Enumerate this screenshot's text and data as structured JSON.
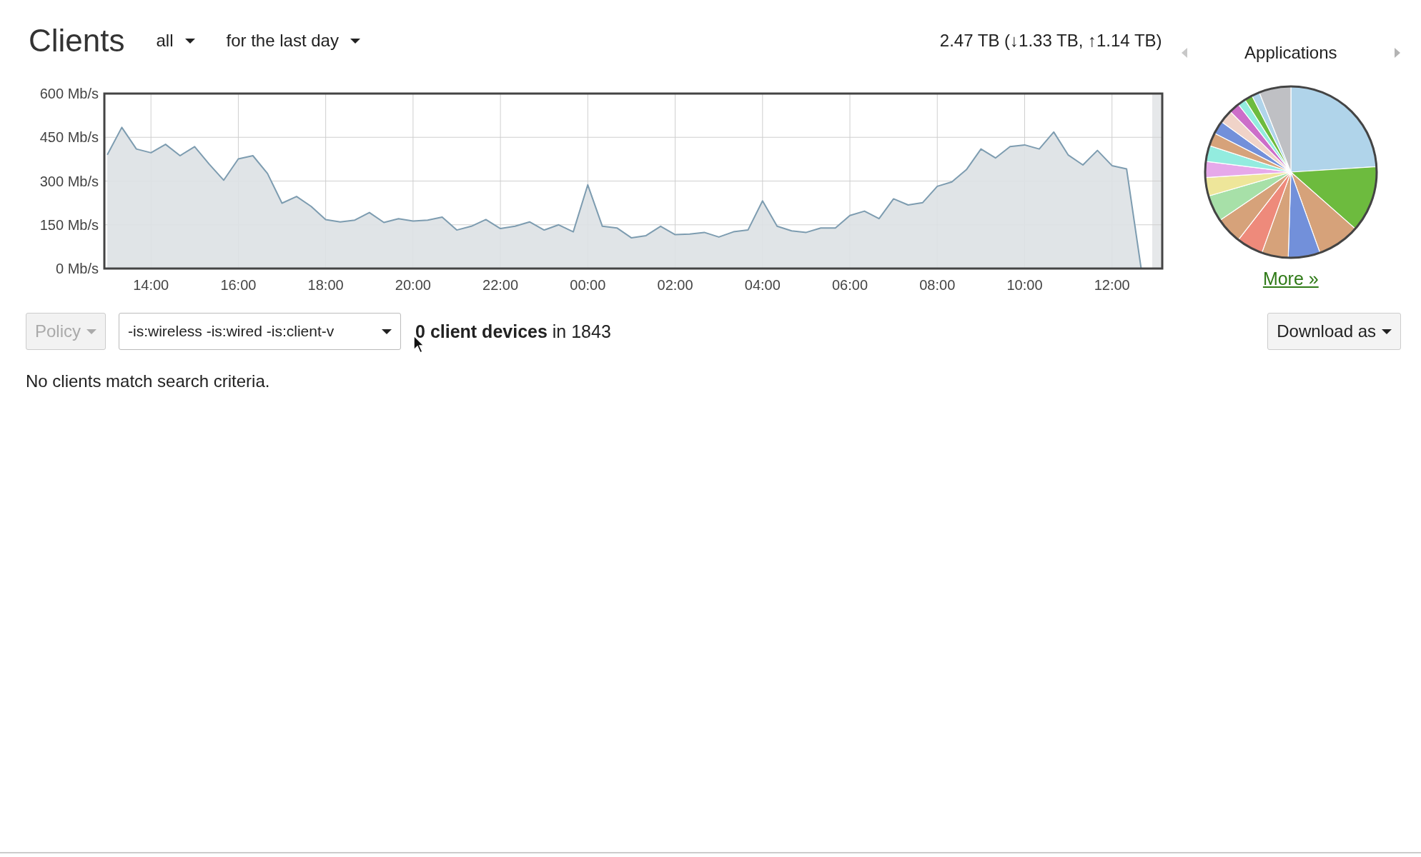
{
  "header": {
    "title": "Clients",
    "filter": "all",
    "period": "for the last day",
    "total": "2.47 TB (↓1.33 TB, ↑1.14 TB)"
  },
  "traffic": {
    "chart_data": {
      "type": "area",
      "grid": true,
      "ylim": [
        0,
        600
      ],
      "yticks": [
        {
          "value": 0,
          "label": "0 Mb/s"
        },
        {
          "value": 150,
          "label": "150 Mb/s"
        },
        {
          "value": 300,
          "label": "300 Mb/s"
        },
        {
          "value": 450,
          "label": "450 Mb/s"
        },
        {
          "value": 600,
          "label": "600 Mb/s"
        }
      ],
      "categories": [
        null,
        null,
        null,
        "14:00",
        null,
        null,
        null,
        null,
        null,
        "16:00",
        null,
        null,
        null,
        null,
        null,
        "18:00",
        null,
        null,
        null,
        null,
        null,
        "20:00",
        null,
        null,
        null,
        null,
        null,
        "22:00",
        null,
        null,
        null,
        null,
        null,
        "00:00",
        null,
        null,
        null,
        null,
        null,
        "02:00",
        null,
        null,
        null,
        null,
        null,
        "04:00",
        null,
        null,
        null,
        null,
        null,
        "06:00",
        null,
        null,
        null,
        null,
        null,
        "08:00",
        null,
        null,
        null,
        null,
        null,
        "10:00",
        null,
        null,
        null,
        null,
        null,
        "12:00",
        null,
        null
      ],
      "series": [
        {
          "color": "#7d9cb0",
          "values": [
            390,
            484,
            410,
            397,
            426,
            387,
            418,
            358,
            303,
            376,
            387,
            326,
            224,
            247,
            213,
            168,
            160,
            166,
            192,
            158,
            171,
            163,
            166,
            176,
            132,
            145,
            168,
            137,
            145,
            160,
            132,
            150,
            126,
            287,
            145,
            139,
            105,
            113,
            145,
            116,
            118,
            124,
            108,
            126,
            132,
            232,
            145,
            129,
            124,
            139,
            139,
            182,
            197,
            171,
            239,
            218,
            226,
            282,
            297,
            339,
            410,
            379,
            418,
            424,
            410,
            468,
            389,
            355,
            405,
            353,
            342,
            0
          ]
        }
      ]
    }
  },
  "applications": {
    "title": "Applications",
    "more_link": "More »"
  },
  "toolbar": {
    "policy": {
      "label": "Policy",
      "disabled": true
    },
    "search": {
      "value": "-is:wireless -is:wired -is:client-v"
    },
    "summary": "**0 client devices** in 1843",
    "download": "Download as"
  },
  "message": "No clients match search criteria."
}
